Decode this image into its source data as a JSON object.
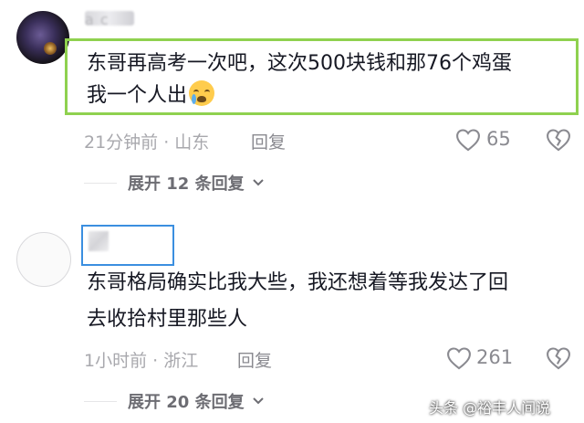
{
  "comments": [
    {
      "username": "a c",
      "content_line1": "东哥再高考一次吧，这次500块钱和那76个鸡蛋",
      "content_line2": "我一个人出",
      "emoji": "crying-face",
      "time_location": "21分钟前 · 山东",
      "reply_label": "回复",
      "like_count": "65",
      "expand_label": "展开 12 条回复",
      "expand_icon": "chevron-down-icon"
    },
    {
      "content_line1": "东哥格局确实比我大些，我还想着等我发达了回",
      "content_line2": "去收拾村里那些人",
      "time_location": "1小时前 · 浙江",
      "reply_label": "回复",
      "like_count": "261",
      "expand_label": "展开 20 条回复",
      "expand_icon": "chevron-down-icon"
    }
  ],
  "watermark": "头条 @裕丰人间说",
  "colors": {
    "highlight_green": "#8fd14f",
    "highlight_blue": "#3b8fe0",
    "meta_gray": "#a8a8ad"
  }
}
